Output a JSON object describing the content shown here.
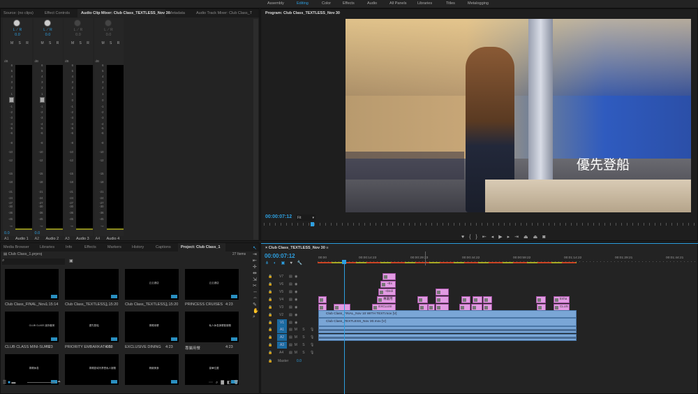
{
  "workspaces": [
    "Assembly",
    "Editing",
    "Color",
    "Effects",
    "Audio",
    "All Panels",
    "Libraries",
    "Titles",
    "Metalogging"
  ],
  "active_workspace": "Editing",
  "source_panel": {
    "tabs": [
      "Source: (no clips)",
      "Effect Controls",
      "Audio Clip Mixer: Club Class_TEXTLESS_Nov 30",
      "Metadata",
      "Audio Track Mixer: Club Class_T"
    ],
    "active_tab": 2,
    "channels": [
      {
        "id": "A1",
        "name": "Audio 1",
        "pan": "0.0",
        "level": "0.0",
        "active": true
      },
      {
        "id": "A2",
        "name": "Audio 2",
        "pan": "0.0",
        "level": "0.0",
        "active": true
      },
      {
        "id": "A3",
        "name": "Audio 3",
        "pan": "0.0",
        "level": "",
        "active": false
      },
      {
        "id": "A4",
        "name": "Audio 4",
        "pan": "0.0",
        "level": "",
        "active": false
      }
    ],
    "pan_label": "L ⟋ R",
    "msr": "M S R",
    "db_label": "dB",
    "scale": [
      "6",
      "5",
      "4",
      "3",
      "2",
      "1",
      "0",
      "-1",
      "-2",
      "-3",
      "-4",
      "-5",
      "-6",
      "-8",
      "-10",
      "-12",
      "-15",
      "-18",
      "-21",
      "-24",
      "-27",
      "-30",
      "-36",
      "-45",
      "-∞"
    ]
  },
  "program": {
    "title": "Program: Club Class_TEXTLESS_Nov 30",
    "timecode": "00:00:07:12",
    "zoom": "Fit",
    "subtitle": "優先登船"
  },
  "project": {
    "tabs": [
      "Media Browser",
      "Libraries",
      "Info",
      "Effects",
      "Markers",
      "History",
      "Captions",
      "Project: Club Class_1"
    ],
    "active_tab": 7,
    "file": "Club Class_1.prproj",
    "count": "27 Items",
    "items": [
      {
        "name": "Club Class_FINAL_Nov...",
        "dur": "1:15:14",
        "text": ""
      },
      {
        "name": "Club Class_TEXTLESS_...",
        "dur": "1:15:20",
        "text": ""
      },
      {
        "name": "Club Class_TEXTLESS_...",
        "dur": "1:15:20",
        "text": "云云酒店"
      },
      {
        "name": "PRINCESS CRUISES",
        "dur": "4:23",
        "text": "云云酒店"
      },
      {
        "name": "CLUB CLASS MINI-SUITE",
        "dur": "4:23",
        "text": "CLUB CLASS 迷你套房"
      },
      {
        "name": "PRIORITY EMBARKATION",
        "dur": "4:23",
        "text": "優先登船"
      },
      {
        "name": "EXCLUSIVE DINING",
        "dur": "4:23",
        "text": "專屬用餐"
      },
      {
        "name": "專屬用餐",
        "dur": "4:23",
        "text": "私人休息與餐飲服務"
      },
      {
        "name": "",
        "dur": "",
        "text": "專屬休息"
      },
      {
        "name": "",
        "dur": "",
        "text": "專屬區域內享受私人服務"
      },
      {
        "name": "",
        "dur": "",
        "text": "精緻美食"
      },
      {
        "name": "",
        "dur": "",
        "text": "豪華位置"
      }
    ]
  },
  "timeline": {
    "title": "Club Class_TEXTLESS_Nov 30",
    "timecode": "00:00:07:12",
    "playhead_seconds": 7.5,
    "ruler": [
      "00:00",
      "00:00:14:23",
      "00:00:29:23",
      "00:00:44:22",
      "00:00:59:22",
      "00:01:14:22",
      "00:01:29:21",
      "00:01:44:21"
    ],
    "video_tracks": [
      "V7",
      "V6",
      "V5",
      "V4",
      "V3",
      "V2",
      "V1"
    ],
    "audio_tracks": [
      "A1",
      "A2",
      "A3",
      "A4"
    ],
    "master_label": "Master",
    "master_value": "0.0",
    "graphic_clips": [
      {
        "t": "V4",
        "s": 0,
        "e": 2.5,
        "l": ""
      },
      {
        "t": "V3",
        "s": 0,
        "e": 2.5,
        "l": ""
      },
      {
        "t": "V3",
        "s": 4.5,
        "e": 9.5,
        "l": ""
      },
      {
        "t": "V7",
        "s": 18.8,
        "e": 22.7,
        "l": ""
      },
      {
        "t": "V6",
        "s": 18.2,
        "e": 22.7,
        "l": "~Ex"
      },
      {
        "t": "V5",
        "s": 17.6,
        "e": 22.7,
        "l": "~Dedi"
      },
      {
        "t": "V4",
        "s": 17.2,
        "e": 22.7,
        "l": "專屬用"
      },
      {
        "t": "V3",
        "s": 15.8,
        "e": 22.7,
        "l": "EXCLUSI"
      },
      {
        "t": "V5",
        "s": 34.4,
        "e": 38.2,
        "l": ""
      },
      {
        "t": "V4",
        "s": 29.1,
        "e": 32.1,
        "l": ""
      },
      {
        "t": "V4",
        "s": 34.4,
        "e": 38.2,
        "l": ""
      },
      {
        "t": "V4",
        "s": 41.9,
        "e": 44.6,
        "l": ""
      },
      {
        "t": "V4",
        "s": 45.2,
        "e": 48,
        "l": ""
      },
      {
        "t": "V4",
        "s": 48.2,
        "e": 50.9,
        "l": ""
      },
      {
        "t": "V3",
        "s": 29.5,
        "e": 32.1,
        "l": ""
      },
      {
        "t": "V3",
        "s": 32.1,
        "e": 34.2,
        "l": ""
      },
      {
        "t": "V3",
        "s": 34.4,
        "e": 38.2,
        "l": ""
      },
      {
        "t": "V3",
        "s": 41.3,
        "e": 44.6,
        "l": ""
      },
      {
        "t": "V3",
        "s": 44.8,
        "e": 48,
        "l": ""
      },
      {
        "t": "V3",
        "s": 48.2,
        "e": 50.9,
        "l": ""
      },
      {
        "t": "V4",
        "s": 63.8,
        "e": 66.7,
        "l": ""
      },
      {
        "t": "V3",
        "s": 64,
        "e": 66.7,
        "l": ""
      },
      {
        "t": "V4",
        "s": 68.9,
        "e": 73.7,
        "l": "Enha"
      },
      {
        "t": "V3",
        "s": 68.9,
        "e": 73.7,
        "l": "CLUS"
      }
    ],
    "video_clips": [
      {
        "t": "V2",
        "s": 0,
        "e": 75.6,
        "l": "Club Class_FINAL_Nov 10 WITH TEXT.mov [V]"
      },
      {
        "t": "V1",
        "s": 0,
        "e": 75.6,
        "l": "Club Class_TEXTLESS_Nov 30.mov [V]"
      }
    ],
    "audio_clips": [
      {
        "t": "A1",
        "s": 0,
        "e": 75.6
      },
      {
        "t": "A2",
        "s": 0,
        "e": 75.6
      }
    ]
  },
  "colors": {
    "accent": "#2d9fe0",
    "graphic_clip": "#e29be3",
    "video_clip": "#7aa6d6"
  }
}
